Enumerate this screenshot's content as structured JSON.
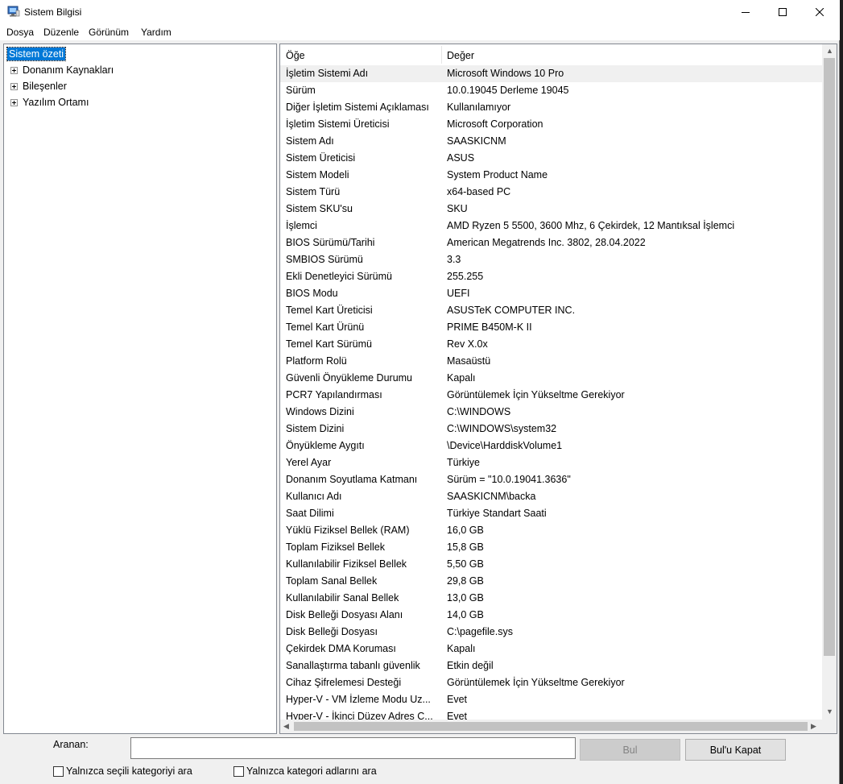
{
  "window": {
    "title": "Sistem Bilgisi"
  },
  "menu": [
    "Dosya",
    "Düzenle",
    "Görünüm",
    "Yardım"
  ],
  "tree": {
    "root": "Sistem özeti",
    "children": [
      "Donanım Kaynakları",
      "Bileşenler",
      "Yazılım Ortamı"
    ]
  },
  "table": {
    "headers": [
      "Öğe",
      "Değer"
    ],
    "rows": [
      [
        "İşletim Sistemi Adı",
        "Microsoft Windows 10 Pro"
      ],
      [
        "Sürüm",
        "10.0.19045 Derleme 19045"
      ],
      [
        "Diğer İşletim Sistemi Açıklaması",
        "Kullanılamıyor"
      ],
      [
        "İşletim Sistemi Üreticisi",
        "Microsoft Corporation"
      ],
      [
        "Sistem Adı",
        "SAASKICNM"
      ],
      [
        "Sistem Üreticisi",
        "ASUS"
      ],
      [
        "Sistem Modeli",
        "System Product Name"
      ],
      [
        "Sistem Türü",
        "x64-based PC"
      ],
      [
        "Sistem SKU'su",
        "SKU"
      ],
      [
        "İşlemci",
        "AMD Ryzen 5 5500, 3600 Mhz, 6 Çekirdek, 12 Mantıksal İşlemci"
      ],
      [
        "BIOS Sürümü/Tarihi",
        "American Megatrends Inc. 3802, 28.04.2022"
      ],
      [
        "SMBIOS Sürümü",
        "3.3"
      ],
      [
        "Ekli Denetleyici Sürümü",
        "255.255"
      ],
      [
        "BIOS Modu",
        "UEFI"
      ],
      [
        "Temel Kart Üreticisi",
        "ASUSTeK COMPUTER INC."
      ],
      [
        "Temel Kart Ürünü",
        "PRIME B450M-K II"
      ],
      [
        "Temel Kart Sürümü",
        "Rev X.0x"
      ],
      [
        "Platform Rolü",
        "Masaüstü"
      ],
      [
        "Güvenli Önyükleme Durumu",
        "Kapalı"
      ],
      [
        "PCR7 Yapılandırması",
        "Görüntülemek İçin Yükseltme Gerekiyor"
      ],
      [
        "Windows Dizini",
        "C:\\WINDOWS"
      ],
      [
        "Sistem Dizini",
        "C:\\WINDOWS\\system32"
      ],
      [
        "Önyükleme Aygıtı",
        "\\Device\\HarddiskVolume1"
      ],
      [
        "Yerel Ayar",
        "Türkiye"
      ],
      [
        "Donanım Soyutlama Katmanı",
        "Sürüm = \"10.0.19041.3636\""
      ],
      [
        "Kullanıcı Adı",
        "SAASKICNM\\backa"
      ],
      [
        "Saat Dilimi",
        "Türkiye Standart Saati"
      ],
      [
        "Yüklü Fiziksel Bellek (RAM)",
        "16,0 GB"
      ],
      [
        "Toplam Fiziksel Bellek",
        "15,8 GB"
      ],
      [
        "Kullanılabilir Fiziksel Bellek",
        "5,50 GB"
      ],
      [
        "Toplam Sanal Bellek",
        "29,8 GB"
      ],
      [
        "Kullanılabilir Sanal Bellek",
        "13,0 GB"
      ],
      [
        "Disk Belleği Dosyası Alanı",
        "14,0 GB"
      ],
      [
        "Disk Belleği Dosyası",
        "C:\\pagefile.sys"
      ],
      [
        "Çekirdek DMA Koruması",
        "Kapalı"
      ],
      [
        "Sanallaştırma tabanlı güvenlik",
        "Etkin değil"
      ],
      [
        "Cihaz Şifrelemesi Desteği",
        "Görüntülemek İçin Yükseltme Gerekiyor"
      ],
      [
        "Hyper-V - VM İzleme Modu Uz...",
        "Evet"
      ],
      [
        "Hyper-V - İkinci Düzey Adres Ç...",
        "Evet"
      ]
    ]
  },
  "search": {
    "label": "Aranan:",
    "value": "",
    "find_label": "Bul",
    "close_label": "Bul'u Kapat",
    "only_selected_label": "Yalnızca seçili kategoriyi ara",
    "only_names_label": "Yalnızca kategori adlarını ara"
  },
  "colors": {
    "selection": "#0078d7",
    "row_highlight": "#f0f0f0"
  }
}
